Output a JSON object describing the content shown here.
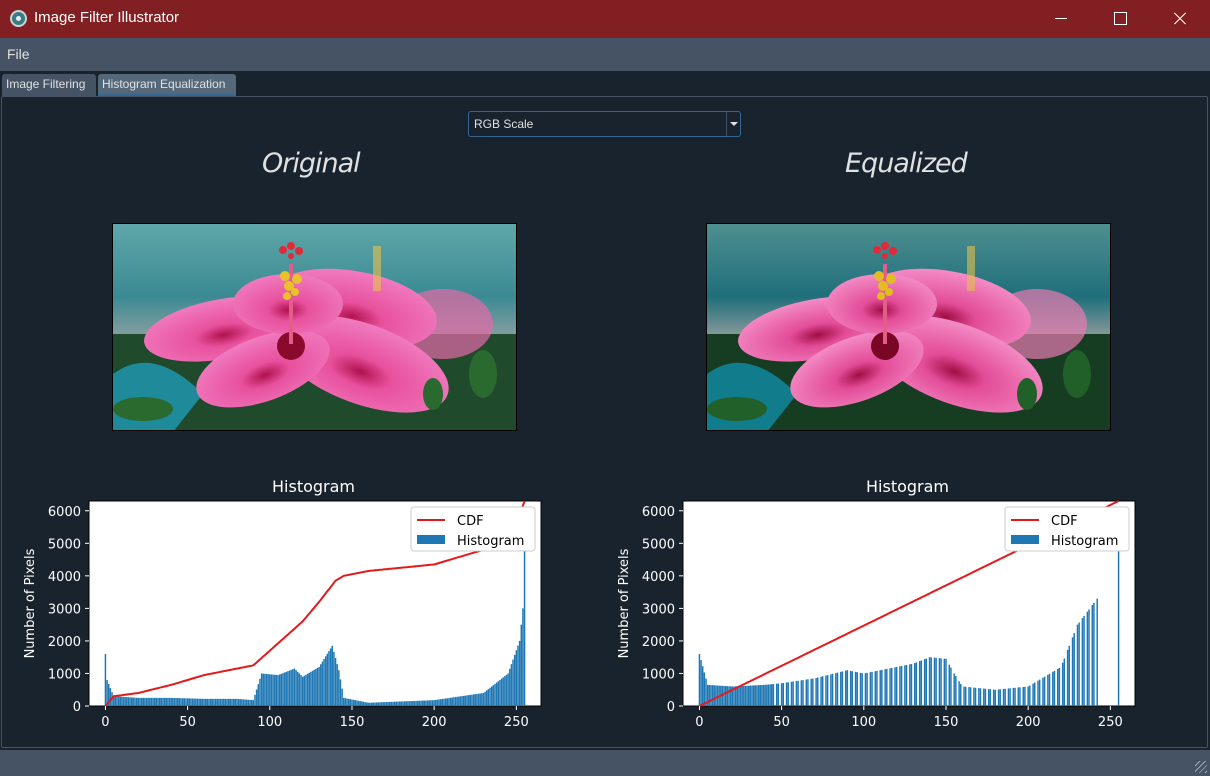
{
  "window": {
    "title": "Image Filter Illustrator",
    "app_icon": "camera-lens-icon"
  },
  "menu": {
    "file": "File"
  },
  "tabs": [
    {
      "label": "Image Filtering",
      "active": false
    },
    {
      "label": "Histogram Equalization",
      "active": true
    }
  ],
  "combo": {
    "selected": "RGB Scale"
  },
  "panels": {
    "left": {
      "heading": "Original",
      "hist_title": "Histogram"
    },
    "right": {
      "heading": "Equalized",
      "hist_title": "Histogram"
    }
  },
  "colors": {
    "bar": "#1f77b4",
    "cdf": "#e31a1c",
    "titlebar": "#821f22",
    "accent": "#346792"
  },
  "chart_data": [
    {
      "type": "bar",
      "title": "Histogram",
      "ylabel": "Number of Pixels",
      "xlabel": "",
      "xlim": [
        -10,
        265
      ],
      "ylim": [
        0,
        6300
      ],
      "xticks": [
        0,
        50,
        100,
        150,
        200,
        250
      ],
      "yticks": [
        0,
        1000,
        2000,
        3000,
        4000,
        5000,
        6000
      ],
      "legend": [
        "CDF",
        "Histogram"
      ],
      "legend_position": "top-right",
      "histogram": [
        [
          0,
          1600
        ],
        [
          1,
          800
        ],
        [
          5,
          300
        ],
        [
          20,
          250
        ],
        [
          40,
          250
        ],
        [
          60,
          220
        ],
        [
          80,
          220
        ],
        [
          90,
          180
        ],
        [
          95,
          1000
        ],
        [
          105,
          950
        ],
        [
          115,
          1150
        ],
        [
          120,
          900
        ],
        [
          130,
          1200
        ],
        [
          138,
          1850
        ],
        [
          142,
          1100
        ],
        [
          145,
          250
        ],
        [
          160,
          100
        ],
        [
          200,
          180
        ],
        [
          230,
          400
        ],
        [
          245,
          1000
        ],
        [
          252,
          2000
        ],
        [
          254,
          3000
        ],
        [
          255,
          5500
        ]
      ],
      "cdf": [
        [
          0,
          0
        ],
        [
          5,
          300
        ],
        [
          20,
          400
        ],
        [
          40,
          650
        ],
        [
          60,
          950
        ],
        [
          80,
          1150
        ],
        [
          90,
          1250
        ],
        [
          100,
          1700
        ],
        [
          110,
          2150
        ],
        [
          120,
          2600
        ],
        [
          130,
          3200
        ],
        [
          140,
          3850
        ],
        [
          145,
          4000
        ],
        [
          160,
          4150
        ],
        [
          200,
          4350
        ],
        [
          230,
          4800
        ],
        [
          250,
          5600
        ],
        [
          255,
          6300
        ]
      ]
    },
    {
      "type": "bar",
      "title": "Histogram",
      "ylabel": "Number of Pixels",
      "xlabel": "",
      "xlim": [
        -10,
        265
      ],
      "ylim": [
        0,
        6300
      ],
      "xticks": [
        0,
        50,
        100,
        150,
        200,
        250
      ],
      "yticks": [
        0,
        1000,
        2000,
        3000,
        4000,
        5000,
        6000
      ],
      "legend": [
        "CDF",
        "Histogram"
      ],
      "legend_position": "top-right",
      "histogram": [
        [
          0,
          1600
        ],
        [
          5,
          650
        ],
        [
          20,
          600
        ],
        [
          40,
          650
        ],
        [
          50,
          700
        ],
        [
          70,
          850
        ],
        [
          90,
          1100
        ],
        [
          100,
          1000
        ],
        [
          110,
          1100
        ],
        [
          120,
          1200
        ],
        [
          130,
          1300
        ],
        [
          140,
          1500
        ],
        [
          150,
          1450
        ],
        [
          155,
          1000
        ],
        [
          160,
          600
        ],
        [
          180,
          500
        ],
        [
          200,
          600
        ],
        [
          220,
          1200
        ],
        [
          230,
          2500
        ],
        [
          242,
          3300
        ],
        [
          255,
          5500
        ]
      ],
      "cdf": [
        [
          0,
          0
        ],
        [
          255,
          6300
        ]
      ]
    }
  ]
}
